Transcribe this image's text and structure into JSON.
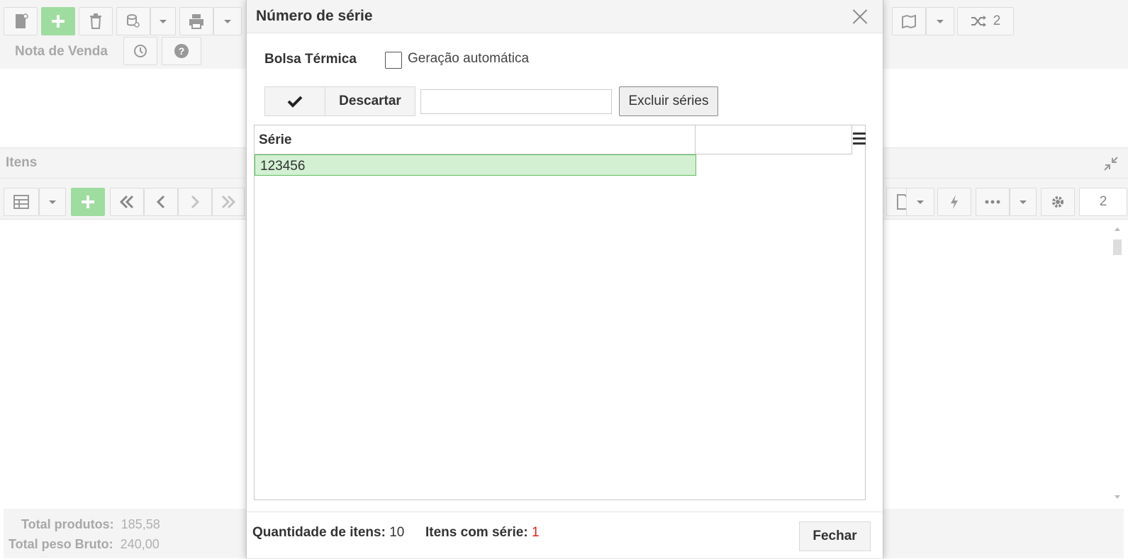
{
  "background": {
    "toolbar_label": "Nota de Venda",
    "shuffle_count": "2",
    "panel_title": "Itens",
    "page_input_value": "2",
    "totals": [
      {
        "label": "Total produtos:",
        "value": "185,58"
      },
      {
        "label": "Total peso Bruto:",
        "value": "240,00"
      }
    ]
  },
  "modal": {
    "title": "Número de série",
    "product_name": "Bolsa Térmica",
    "auto_generation_label": "Geração automática",
    "auto_generation_checked": false,
    "discard_label": "Descartar",
    "serie_input_value": "",
    "delete_series_label": "Excluir séries",
    "grid": {
      "column_header": "Série",
      "rows": [
        {
          "serie": "123456"
        }
      ]
    },
    "footer": {
      "quantity_label": "Quantidade de itens:",
      "quantity_value": "10",
      "with_serie_label": "Itens com série:",
      "with_serie_value": "1",
      "with_serie_color": "#e0201a",
      "close_label": "Fechar"
    }
  },
  "colors": {
    "accent_green": "#9fdc9f",
    "selected_row_bg": "#d3f0d3",
    "selected_row_border": "#5fbf5f"
  }
}
